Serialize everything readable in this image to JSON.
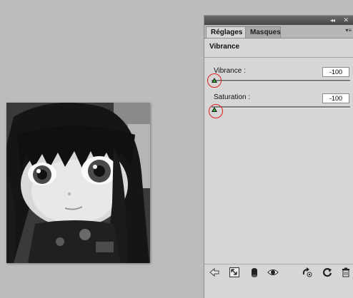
{
  "panel": {
    "tabs": [
      {
        "label": "Réglages",
        "active": true
      },
      {
        "label": "Masques",
        "active": false
      }
    ],
    "collapse_glyph": "◂◂",
    "close_glyph": "✕",
    "menu_glyph": "▾≡",
    "adjustment_title": "Vibrance",
    "controls": [
      {
        "label": "Vibrance :",
        "value": "-100",
        "slider_min": -100,
        "slider_max": 100
      },
      {
        "label": "Saturation :",
        "value": "-100",
        "slider_min": -100,
        "slider_max": 100
      }
    ],
    "toolbar_icons": [
      "back-arrow-icon",
      "expand-view-icon",
      "clip-to-layer-icon",
      "visibility-eye-icon",
      "view-previous-state-icon",
      "reset-icon",
      "trash-icon"
    ]
  },
  "image": {
    "subject": "grayscale doll portrait"
  },
  "colors": {
    "workspace_bg": "#bcbcbc",
    "panel_bg": "#d6d6d6",
    "highlight_marker": "#e01c1c",
    "slider_thumb_accent": "#2fc02f"
  }
}
